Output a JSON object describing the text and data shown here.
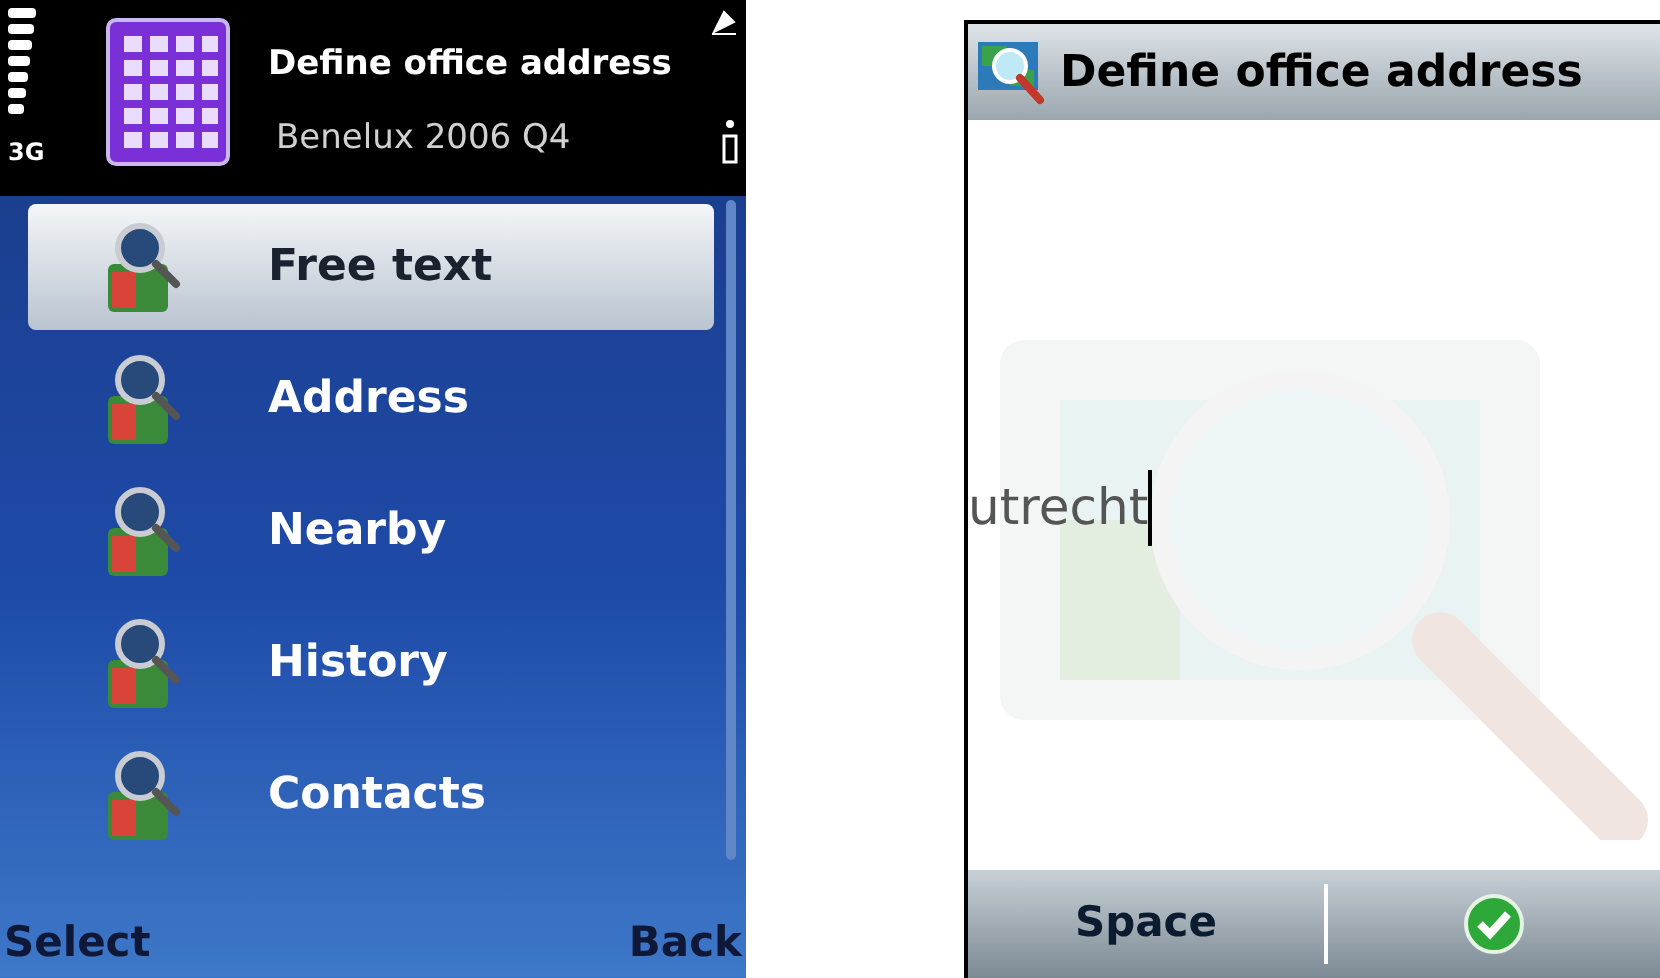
{
  "menu_screen": {
    "network": "3G",
    "title": "Define office address",
    "subtitle": "Benelux 2006 Q4",
    "items": [
      {
        "label": "Free text",
        "selected": true
      },
      {
        "label": "Address",
        "selected": false
      },
      {
        "label": "Nearby",
        "selected": false
      },
      {
        "label": "History",
        "selected": false
      },
      {
        "label": "Contacts",
        "selected": false
      }
    ],
    "softkeys": {
      "left": "Select",
      "right": "Back"
    }
  },
  "entry_screen": {
    "title": "Define office address",
    "value": "utrecht",
    "softkey_left": "Space"
  }
}
